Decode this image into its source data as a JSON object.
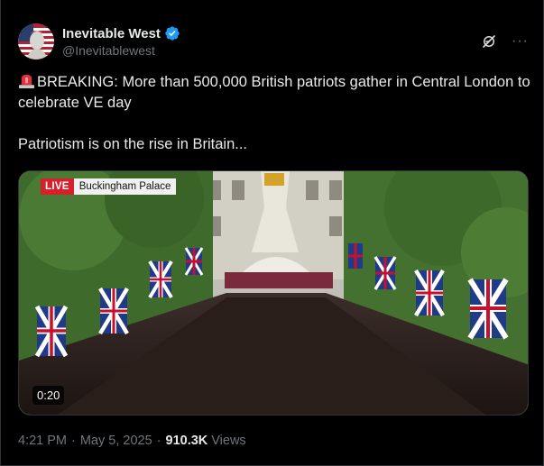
{
  "author": {
    "display_name": "Inevitable West",
    "handle": "@Inevitablewest",
    "avatar_icon": "statue-flag-avatar",
    "verified_icon": "verified-badge-icon",
    "verified_color": "#1d9bf0"
  },
  "header_actions": {
    "grok_icon": "grok-icon",
    "more_label": "···"
  },
  "tweet": {
    "line1_emoji": "rotating-light-icon",
    "line1": "BREAKING: More than 500,000 British patriots gather in Central London to celebrate VE day",
    "line2": "Patriotism is on the rise in Britain..."
  },
  "media": {
    "live_label": "LIVE",
    "location_label": "Buckingham Palace",
    "duration": "0:20",
    "live_color": "#d6202b"
  },
  "meta": {
    "time": "4:21 PM",
    "date": "May 5, 2025",
    "separator": "·",
    "views_count": "910.3K",
    "views_label": "Views"
  },
  "colors": {
    "background": "#000000",
    "text": "#e7e9ea",
    "muted": "#71767b"
  }
}
